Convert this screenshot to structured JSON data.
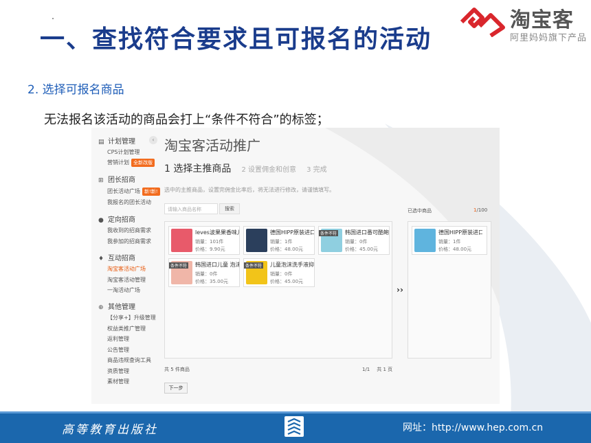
{
  "slide": {
    "title": "一、查找符合要求且可报名的活动",
    "subheading": "2. 选择可报名商品",
    "description": "无法报名该活动的商品会打上“条件不符合”的标签；"
  },
  "logo": {
    "name": "淘宝客",
    "subtitle": "阿里妈妈旗下产品"
  },
  "sidebar": {
    "groups": [
      {
        "icon": "clipboard-icon",
        "label": "计划管理",
        "items": [
          {
            "label": "CPS计划管理"
          },
          {
            "label": "营销计划",
            "badge": "全新改版"
          }
        ]
      },
      {
        "icon": "grid-icon",
        "label": "团长招商",
        "items": [
          {
            "label": "团长活动广场",
            "badge": "新!新!"
          },
          {
            "label": "我报名的团长活动"
          }
        ]
      },
      {
        "icon": "location-icon",
        "label": "定向招商",
        "items": [
          {
            "label": "我收到的招商需求"
          },
          {
            "label": "我参加的招商需求"
          }
        ]
      },
      {
        "icon": "pin-icon",
        "label": "互动招商",
        "items": [
          {
            "label": "淘宝客活动广场",
            "active": true
          },
          {
            "label": "淘宝客活动管理"
          },
          {
            "label": "一淘活动广场"
          }
        ]
      },
      {
        "icon": "plus-circle-icon",
        "label": "其他管理",
        "items": [
          {
            "label": "【分享+】升级管理"
          },
          {
            "label": "权益类推广管理"
          },
          {
            "label": "返利管理"
          },
          {
            "label": "公告管理"
          },
          {
            "label": "商品违规查询工具"
          },
          {
            "label": "资质管理"
          },
          {
            "label": "素材管理"
          }
        ]
      }
    ]
  },
  "main": {
    "page_title": "淘宝客活动推广",
    "steps": {
      "current": "1 选择主推商品",
      "step2": "2 设置佣金和创意",
      "step3": "3 完成"
    },
    "tip": "选中的主推商品，设置完佣金比率后，将无法进行修改，请谨慎填写。",
    "search_placeholder": "请输入商品名称",
    "search_button": "搜索",
    "products": [
      {
        "name": "leves波果果香味儿",
        "sales": "销量：101件",
        "price": "价格：9.90元",
        "thumb_color": "#e85a6a",
        "tag": ""
      },
      {
        "name": "德国HIPP原装进口",
        "sales": "销量：1件",
        "price": "价格：48.00元",
        "thumb_color": "#2b3f5c",
        "tag": ""
      },
      {
        "name": "韩国进口番可酷鲍",
        "sales": "销量：0件",
        "price": "价格：45.00元",
        "thumb_color": "#8fcfe0",
        "tag": "条件不符"
      },
      {
        "name": "韩国进口儿童 泡沫",
        "sales": "销量：0件",
        "price": "价格：35.00元",
        "thumb_color": "#f0b6a8",
        "tag": "条件不符"
      },
      {
        "name": "儿童泡沫洗手液抑",
        "sales": "销量：0件",
        "price": "价格：45.00元",
        "thumb_color": "#f2c419",
        "tag": "条件不符"
      }
    ],
    "transfer_symbol": "››",
    "selected_label": "已选中商品",
    "selected_count": "1",
    "selected_total": "/100",
    "selected_products": [
      {
        "name": "德国HIPP原装进口",
        "sales": "销量：1件",
        "price": "价格：48.00元",
        "thumb_color": "#5fb4de"
      }
    ],
    "total_text": "共 5 件商品",
    "pager_page": "1/1",
    "pager_total": "共 1 页",
    "next_button": "下一步"
  },
  "footer": {
    "publisher": "高等教育出版社",
    "website": "网址：http://www.hep.com.cn"
  },
  "colors": {
    "title": "#1a3c8c",
    "footer": "#1b67ad",
    "accent": "#f26b1d"
  }
}
